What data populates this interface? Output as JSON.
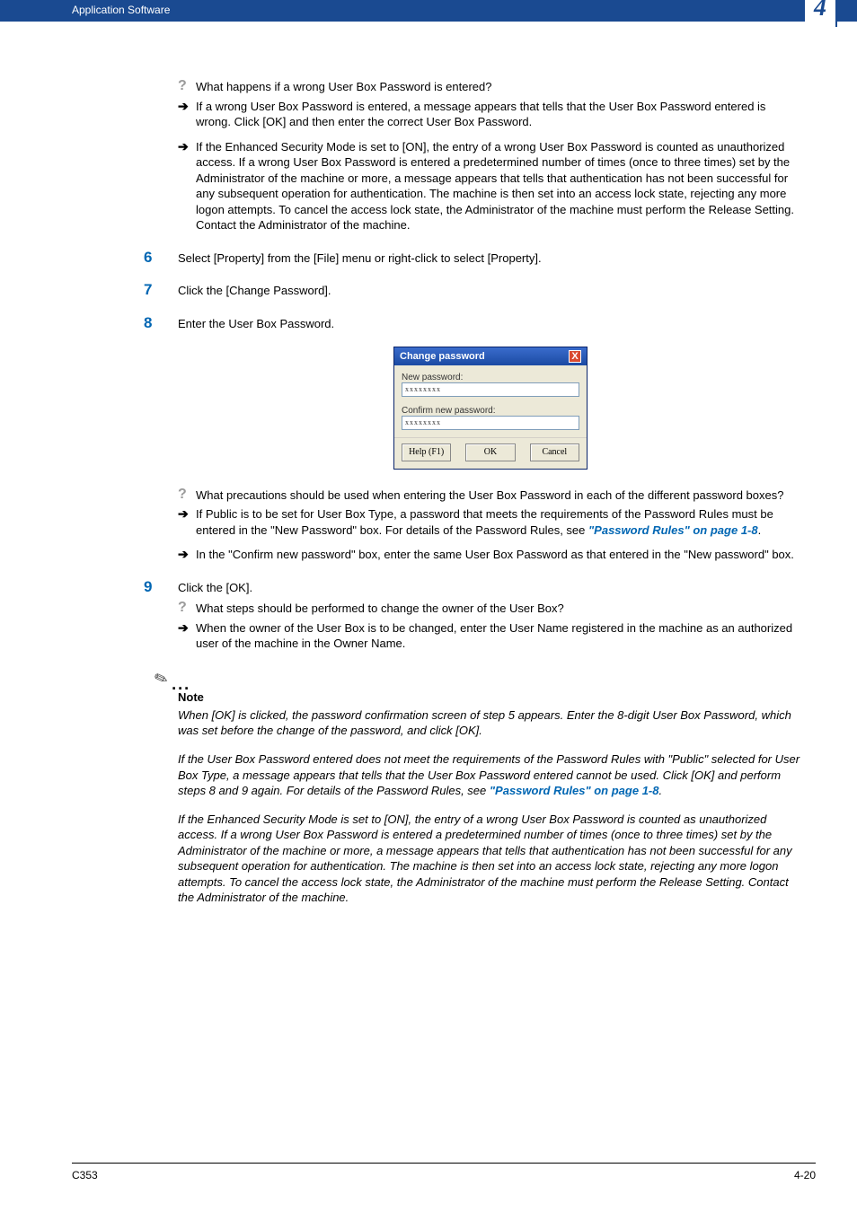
{
  "header": {
    "section_title": "Application Software",
    "chapter_number": "4"
  },
  "qa_block_1": {
    "question": "What happens if a wrong User Box Password is entered?",
    "answer1": "If a wrong User Box Password is entered, a message appears that tells that the User Box Password entered is wrong. Click [OK] and then enter the correct User Box Password.",
    "answer2": "If the Enhanced Security Mode is set to [ON], the entry of a wrong User Box Password is counted as unauthorized access. If a wrong User Box Password is entered a predetermined number of times (once to three times) set by the Administrator of the machine or more, a message appears that tells that authentication has not been successful for any subsequent operation for authentication. The machine is then set into an access lock state, rejecting any more logon attempts. To cancel the access lock state, the Administrator of the machine must perform the Release Setting. Contact the Administrator of the machine."
  },
  "step6": {
    "num": "6",
    "text": "Select [Property] from the [File] menu or right-click to select [Property]."
  },
  "step7": {
    "num": "7",
    "text": "Click the [Change Password]."
  },
  "step8": {
    "num": "8",
    "text": "Enter the User Box Password."
  },
  "dialog": {
    "title": "Change password",
    "label_new": "New password:",
    "value_new": "xxxxxxxx",
    "label_confirm": "Confirm new password:",
    "value_confirm": "xxxxxxxx",
    "btn_help": "Help (F1)",
    "btn_ok": "OK",
    "btn_cancel": "Cancel"
  },
  "qa_block_2": {
    "question": "What precautions should be used when entering the User Box Password in each of the different password boxes?",
    "answer1_a": "If Public is to be set for User Box Type, a password that meets the requirements of the Password Rules must be entered in the \"New Password\" box. For details of the Password Rules, see ",
    "answer1_link": "\"Password Rules\" on page 1-8",
    "answer1_b": ".",
    "answer2": "In the \"Confirm new password\" box, enter the same User Box Password as that entered in the \"New password\" box."
  },
  "step9": {
    "num": "9",
    "text": "Click the [OK]."
  },
  "qa_block_3": {
    "question": "What steps should be performed to change the owner of the User Box?",
    "answer1": "When the owner of the User Box is to be changed, enter the User Name registered in the machine as an authorized user of the machine in the Owner Name."
  },
  "note": {
    "label": "Note",
    "p1": "When [OK] is clicked, the password confirmation screen of step 5 appears. Enter the 8-digit User Box Password, which was set before the change of the password, and click [OK].",
    "p2_a": "If the User Box Password entered does not meet the requirements of the Password Rules with \"Public\" selected for User Box Type, a message appears that tells that the User Box Password entered cannot be used. Click [OK] and perform steps 8 and 9 again. For details of the Password Rules, see ",
    "p2_link": "\"Password Rules\" on page 1-8",
    "p2_b": ".",
    "p3": "If the Enhanced Security Mode is set to [ON], the entry of a wrong User Box Password is counted as unauthorized access. If a wrong User Box Password is entered a predetermined number of times (once to three times) set by the Administrator of the machine or more, a message appears that tells that authentication has not been successful for any subsequent operation for authentication. The machine is then set into an access lock state, rejecting any more logon attempts. To cancel the access lock state, the Administrator of the machine must perform the Release Setting. Contact the Administrator of the machine."
  },
  "footer": {
    "left": "C353",
    "right": "4-20"
  }
}
